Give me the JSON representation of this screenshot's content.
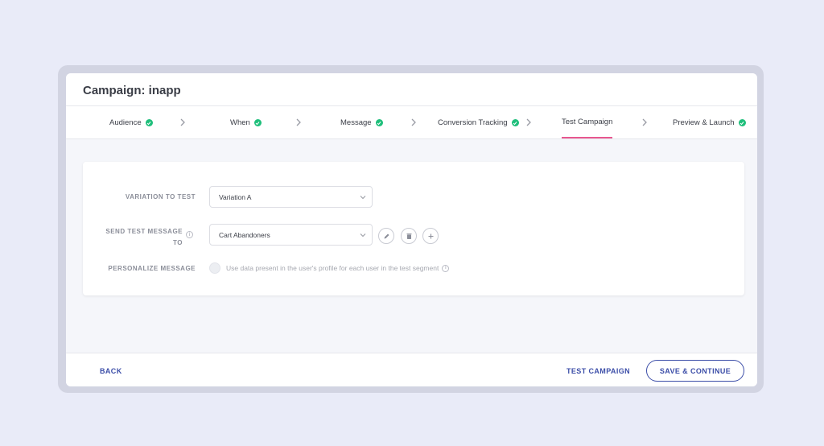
{
  "header": {
    "title": "Campaign: inapp"
  },
  "steps": [
    {
      "label": "Audience",
      "complete": true
    },
    {
      "label": "When",
      "complete": true
    },
    {
      "label": "Message",
      "complete": true
    },
    {
      "label": "Conversion Tracking",
      "complete": true
    },
    {
      "label": "Test Campaign",
      "complete": false,
      "active": true
    },
    {
      "label": "Preview & Launch",
      "complete": true
    }
  ],
  "form": {
    "variation_label": "VARIATION TO TEST",
    "variation_value": "Variation A",
    "send_label_line1": "SEND TEST MESSAGE",
    "send_label_line2": "TO",
    "send_value": "Cart Abandoners",
    "personalize_label": "PERSONALIZE MESSAGE",
    "personalize_text": "Use data present in the user's profile for each user in the test segment"
  },
  "footer": {
    "back_label": "BACK",
    "test_label": "TEST CAMPAIGN",
    "save_label": "SAVE & CONTINUE"
  },
  "colors": {
    "accent": "#3c4ea8",
    "active_tab": "#e8578f",
    "check": "#1fbf7b"
  }
}
